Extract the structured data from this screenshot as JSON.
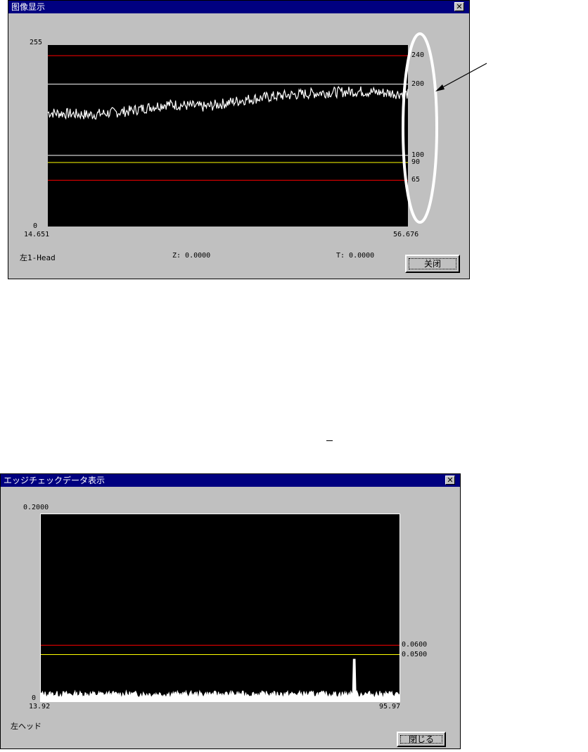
{
  "window1": {
    "title": "图像显示",
    "close_glyph": "✕",
    "y_top_label": "255",
    "y_bottom_label": "0",
    "x_start_label": "14.651",
    "x_end_label": "56.676",
    "head_label": "左1-Head",
    "z_text": "Z:  0.0000",
    "t_text": "T:   0.0000",
    "close_button": "关闭",
    "threshold_lines": [
      {
        "value": 240,
        "label": "240",
        "color": "#ff0000"
      },
      {
        "value": 200,
        "label": "200",
        "color": "#ffffff"
      },
      {
        "value": 100,
        "label": "100",
        "color": "#ffffff"
      },
      {
        "value": 90,
        "label": "90",
        "color": "#ffff00"
      },
      {
        "value": 65,
        "label": "65",
        "color": "#ff0000"
      }
    ]
  },
  "window2": {
    "title": "エッジチェックデータ表示",
    "close_glyph": "✕",
    "y_top_label": "0.2000",
    "y_bottom_label": "0",
    "x_start_label": "13.92",
    "x_end_label": "95.97",
    "head_label": "左ヘッド",
    "close_button": "閉じる",
    "threshold_lines": [
      {
        "value": 0.06,
        "label": "0.0600",
        "color": "#ff0000"
      },
      {
        "value": 0.05,
        "label": "0.0500",
        "color": "#ffff00"
      }
    ]
  },
  "annotation": {
    "ellipse_color": "#ffffff",
    "arrow_color": "#000000"
  },
  "chart_data": [
    {
      "type": "line",
      "x_range": [
        14.651,
        56.676
      ],
      "ylim": [
        0,
        255
      ],
      "series": [
        {
          "x": [
            14.651,
            19.5,
            24.0,
            28.5,
            33.0,
            37.5,
            42.0,
            46.5,
            51.0,
            56.676
          ],
          "values": [
            160,
            157,
            162,
            172,
            168,
            178,
            184,
            188,
            190,
            186
          ]
        }
      ]
    },
    {
      "type": "line",
      "x_range": [
        13.92,
        95.97
      ],
      "ylim": [
        0,
        0.2
      ],
      "series": [
        {
          "x": [
            13.92,
            20,
            30,
            40,
            50,
            60,
            70,
            80,
            85.6,
            90,
            95.97
          ],
          "values": [
            0.008,
            0.006,
            0.004,
            0.004,
            0.003,
            0.004,
            0.006,
            0.008,
            0.045,
            0.008,
            0.006
          ]
        }
      ]
    }
  ]
}
